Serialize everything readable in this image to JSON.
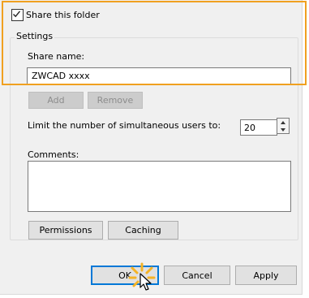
{
  "share_checkbox": {
    "label": "Share this folder",
    "checked": true
  },
  "settings": {
    "group_label": "Settings",
    "share_name_label": "Share name:",
    "share_name_value": "ZWCAD xxxx",
    "add_label": "Add",
    "remove_label": "Remove",
    "limit_label": "Limit the number of simultaneous users to:",
    "limit_value": "20",
    "comments_label": "Comments:",
    "comments_value": ""
  },
  "buttons": {
    "permissions": "Permissions",
    "caching": "Caching",
    "ok": "OK",
    "cancel": "Cancel",
    "apply": "Apply"
  },
  "colors": {
    "highlight_border": "#f0a020",
    "focus_border": "#0078d7",
    "dialog_bg": "#f0f0f0"
  },
  "icons": {
    "checkmark": "checkmark-icon",
    "cursor": "arrow-cursor-icon",
    "click_burst": "click-burst-icon"
  }
}
